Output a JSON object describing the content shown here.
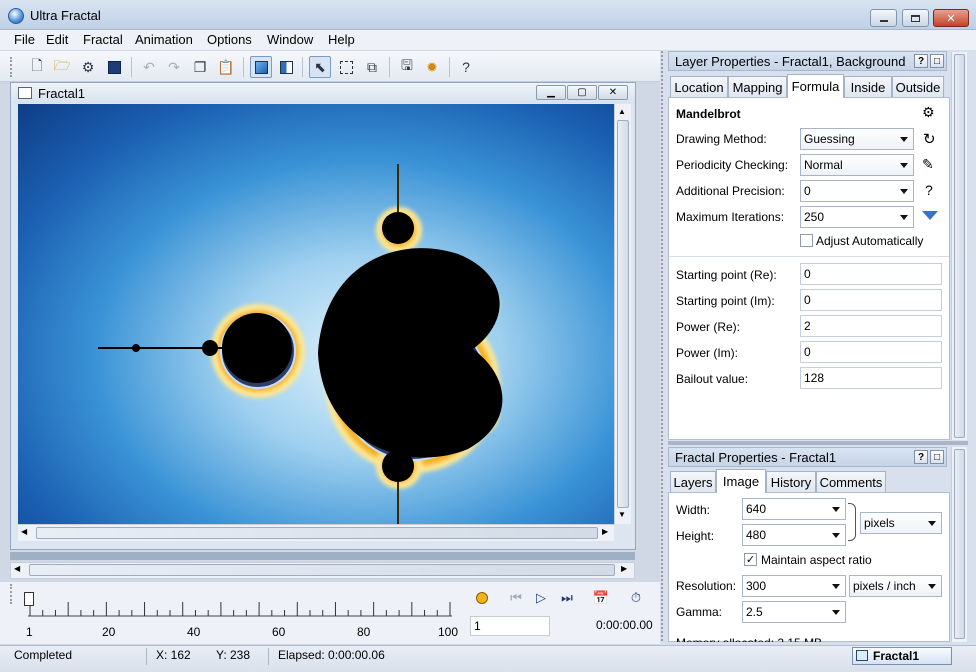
{
  "app": {
    "title": "Ultra Fractal"
  },
  "menu": [
    "File",
    "Edit",
    "Fractal",
    "Animation",
    "Options",
    "Window",
    "Help"
  ],
  "toolbar": {
    "icons": [
      "new-icon",
      "open-icon",
      "open-parameters-icon",
      "save-icon",
      "undo-icon",
      "redo-icon",
      "copy-icon",
      "paste-icon",
      "layer-view-icon",
      "full-view-icon",
      "select-icon",
      "pan-icon",
      "zoom-icon",
      "render-to-disk-icon",
      "gear-icon",
      "help-icon"
    ],
    "help_label": "?"
  },
  "fractal_window": {
    "title": "Fractal1"
  },
  "animation": {
    "ticks": [
      "1",
      "20",
      "40",
      "60",
      "80",
      "100"
    ],
    "frame_value": "1",
    "time": "0:00:00.00"
  },
  "status": {
    "state": "Completed",
    "x": "X: 162",
    "y": "Y: 238",
    "elapsed": "Elapsed: 0:00:00.06",
    "tab": "Fractal1"
  },
  "layer_panel": {
    "title": "Layer Properties - Fractal1, Background",
    "tabs": [
      "Location",
      "Mapping",
      "Formula",
      "Inside",
      "Outside"
    ],
    "active_tab": "Formula",
    "formula_name": "Mandelbrot",
    "rows": [
      {
        "label": "Drawing Method:",
        "value": "Guessing"
      },
      {
        "label": "Periodicity Checking:",
        "value": "Normal"
      },
      {
        "label": "Additional Precision:",
        "value": "0"
      },
      {
        "label": "Maximum Iterations:",
        "value": "250"
      }
    ],
    "adjust_label": "Adjust Automatically",
    "help_label": "?",
    "params": [
      {
        "label": "Starting point (Re):",
        "value": "0"
      },
      {
        "label": "Starting point (Im):",
        "value": "0"
      },
      {
        "label": "Power (Re):",
        "value": "2"
      },
      {
        "label": "Power (Im):",
        "value": "0"
      },
      {
        "label": "Bailout value:",
        "value": "128"
      }
    ]
  },
  "fractal_panel": {
    "title": "Fractal Properties - Fractal1",
    "tabs": [
      "Layers",
      "Image",
      "History",
      "Comments"
    ],
    "active_tab": "Image",
    "width_label": "Width:",
    "width_value": "640",
    "height_label": "Height:",
    "height_value": "480",
    "units": "pixels",
    "aspect_label": "Maintain aspect ratio",
    "aspect_checked": true,
    "resolution_label": "Resolution:",
    "resolution_value": "300",
    "resolution_units": "pixels / inch",
    "gamma_label": "Gamma:",
    "gamma_value": "2.5",
    "memory_text": "Memory allocated: 2.15 MB"
  },
  "panel_buttons": {
    "help": "?",
    "close": "□"
  }
}
